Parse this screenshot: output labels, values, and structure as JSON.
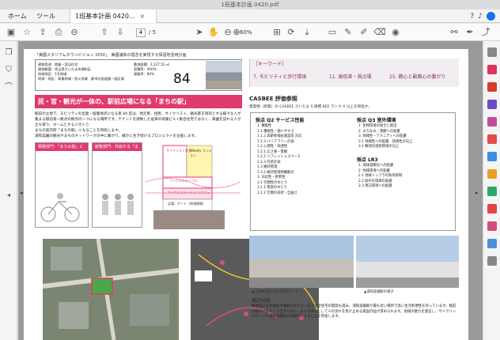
{
  "window": {
    "title": "1班基本計画 0420.pdf"
  },
  "tabs": {
    "home": "ホーム",
    "tools": "ツール",
    "doc": "1班基本計画 0420..."
  },
  "toolbar": {
    "page_current": "4",
    "page_total": "/ 5",
    "zoom": "60%"
  },
  "page": {
    "header": "「美園スタジアムタウンビジョン 2050」　美園浦和の理念を実現する保留地活用計画",
    "info_col1": [
      "建物用途：商業・実店住宅",
      "建物概要：埼玉県さいたま市浦和区",
      "地域地区：1号地域",
      "地域・地区：商業地域・防火地域　都市計画道路一般区域"
    ],
    "info_col2": [
      "敷地面積：2,227.52 ㎡",
      "容積率：400%",
      "建蔽率：80%"
    ],
    "big_number": "84",
    "keyword_title": "［キーワード］",
    "keywords": [
      "7. モビリティと歩行環境",
      "11. 高低差・視点場",
      "25. 都心と副都心の繋がり"
    ],
    "banner": "民・官・観光が一体の、駅前広場になる「まちの駅」",
    "body": [
      "駅前の立地で、モビリティの出発・経着地点になる第 84 区は、地元民、住民、サイクリスト、観光客を目的とする様々な人が集まる駅前第一拠点の拠点の一つになる場所です。テナントを誘致した従来の商業ビル+集合住宅ではなく、来園を訪れる人が立ち寄り、ホームとする人が入り",
      "まちの案内所「まちの駅」になることを目指します。",
      "浦和美園の観光やまちのネットワークの中に繋がり、確かに生き続けるプロジェクトを企画します。"
    ],
    "box1_head": "賑賑部門：「まちの駅」に住む",
    "box2_head": "観覧部門：共創する「まちの駅」",
    "section_labels": [
      "サイクリスト食堂",
      "Weekly マンション",
      "サイクルステーション/カフェ",
      "広場、ゲート（地域情報）",
      "ソーシャルテーブル"
    ],
    "casbee_title": "CASBEE 評価参照",
    "casbee_sub": "建築物（新築）の CASBEE さいたま S 目標 BEE ランク A 以上を目指す。",
    "casbee_q2": "採点 Q2 サービス性能",
    "casbee_q3": "採点 Q3 室外環境",
    "casbee_lr3": "採点 LR3",
    "casbee_items_left": [
      "1. 機能性",
      "1.1 機能性・使いやすさ",
      "1.1.2 高齢者福祉施設室 対応",
      "1.1.3 バリアフリー計画",
      "1.2 心理性・快適性",
      "1.2.1 広さ感・景観",
      "1.2.2 リフレッシュスペース",
      "1.2.3 内装計画",
      "1.3 維持管理",
      "1.3.2 維持管理用機能の",
      "3. 対応性・更新性",
      "3.1 空間性のゆとり",
      "3.1.1 階高のゆとり",
      "3.1.2 空間の形状・自由さ"
    ],
    "casbee_items_right": [
      "1. 生物環境の保全と創出",
      "2. まちなみ・景観への配慮",
      "3. 地域性・アメニティへの配慮",
      "3.1 地域性への配慮、快適性の向上",
      "3.2 敷地内温熱環境の向上"
    ],
    "casbee_items_lr3": [
      "1. 地球温暖化への配慮",
      "2. 地域環境への配慮",
      "2.1 地域インフラの負荷抑制",
      "2.2 既存の環境の配慮",
      "2.3 周辺環境への配慮"
    ],
    "caption1": "▲対象敷地及び西口駅前ロータリー",
    "caption2": "▲浦和美園駅の様子",
    "peri_title": "周辺分析",
    "peri_text": "敷地周辺は保留地や畑地が広がる一方で大型住宅の開発も進み、浦和美園駅が最も近い場所で高い生活利便性を持っています。駅前の賑わいをつくり出すために、まちの中心として人の流れを受け止める施設計画が求められます。地域の魅力を発信し、サイクリングロードと浦和美園駅の結節点とすることを目指します。"
  }
}
